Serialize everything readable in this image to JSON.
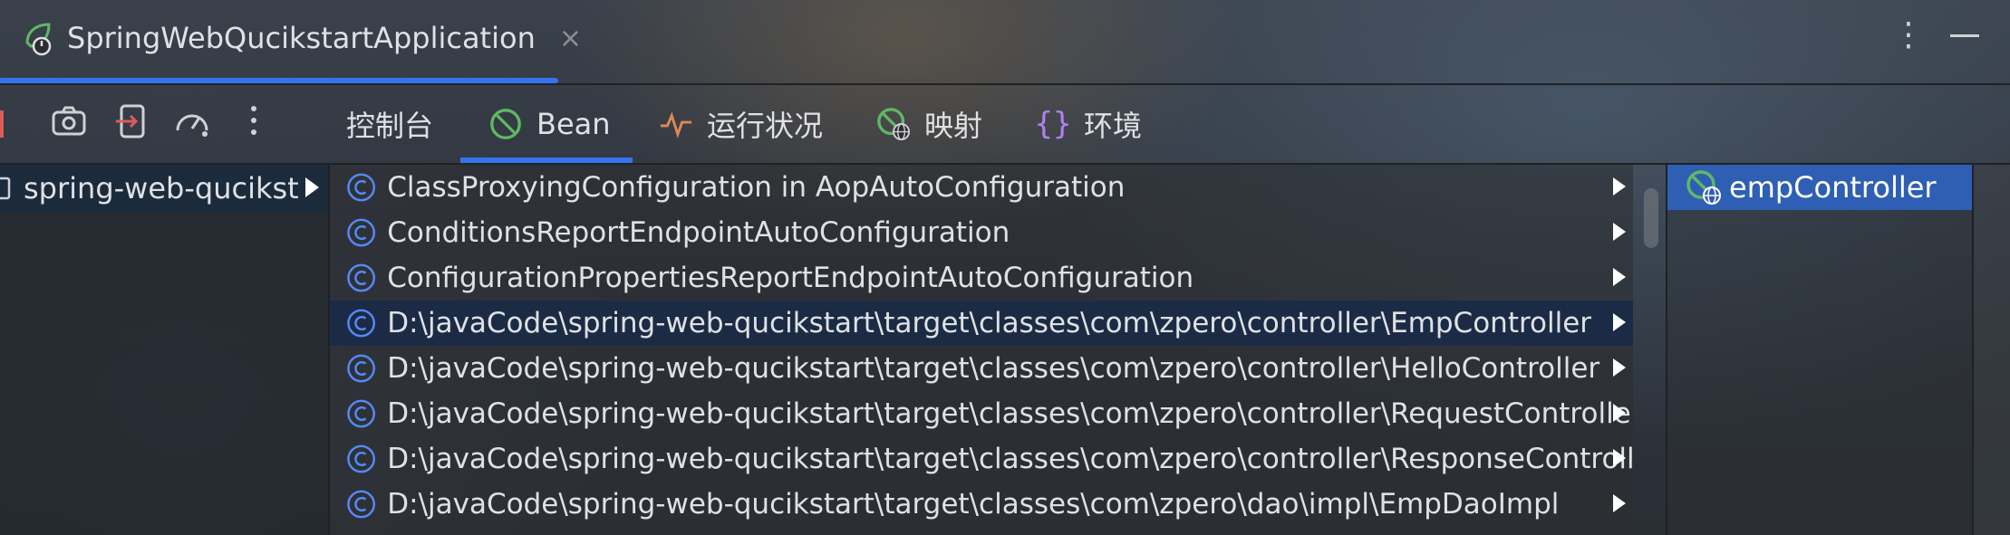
{
  "window": {
    "run_config_name": "SpringWebQucikstartApplication",
    "close_glyph": "×",
    "more_glyph": "⋮"
  },
  "tabs": [
    {
      "label": "控制台",
      "icon": "none"
    },
    {
      "label": "Bean",
      "icon": "bean-icon",
      "active": true
    },
    {
      "label": "运行状况",
      "icon": "health-icon"
    },
    {
      "label": "映射",
      "icon": "mapping-icon"
    },
    {
      "label": "环境",
      "icon": "braces-icon"
    }
  ],
  "toolbar_icons": [
    "stop-icon",
    "screenshot-icon",
    "restore-layout-icon",
    "dashboard-icon",
    "more-vertical-icon"
  ],
  "left_panel": {
    "items": [
      {
        "label": "spring-web-qucikstart"
      }
    ]
  },
  "beans": [
    {
      "label": "ClassProxyingConfiguration in AopAutoConfiguration"
    },
    {
      "label": "ConditionsReportEndpointAutoConfiguration"
    },
    {
      "label": "ConfigurationPropertiesReportEndpointAutoConfiguration"
    },
    {
      "label": "D:\\javaCode\\spring-web-qucikstart\\target\\classes\\com\\zpero\\controller\\EmpController",
      "selected": true
    },
    {
      "label": "D:\\javaCode\\spring-web-qucikstart\\target\\classes\\com\\zpero\\controller\\HelloController"
    },
    {
      "label": "D:\\javaCode\\spring-web-qucikstart\\target\\classes\\com\\zpero\\controller\\RequestController"
    },
    {
      "label": "D:\\javaCode\\spring-web-qucikstart\\target\\classes\\com\\zpero\\controller\\ResponseController"
    },
    {
      "label": "D:\\javaCode\\spring-web-qucikstart\\target\\classes\\com\\zpero\\dao\\impl\\EmpDaoImpl"
    }
  ],
  "right_panel": {
    "items": [
      {
        "label": "empController",
        "icon": "bean-web-icon"
      }
    ]
  },
  "colors": {
    "accent": "#3574f0",
    "selection": "#2f5fb4",
    "bean_green": "#5fb865",
    "class_blue": "#548af7",
    "health_orange": "#e08855",
    "env_purple": "#b180f0"
  }
}
